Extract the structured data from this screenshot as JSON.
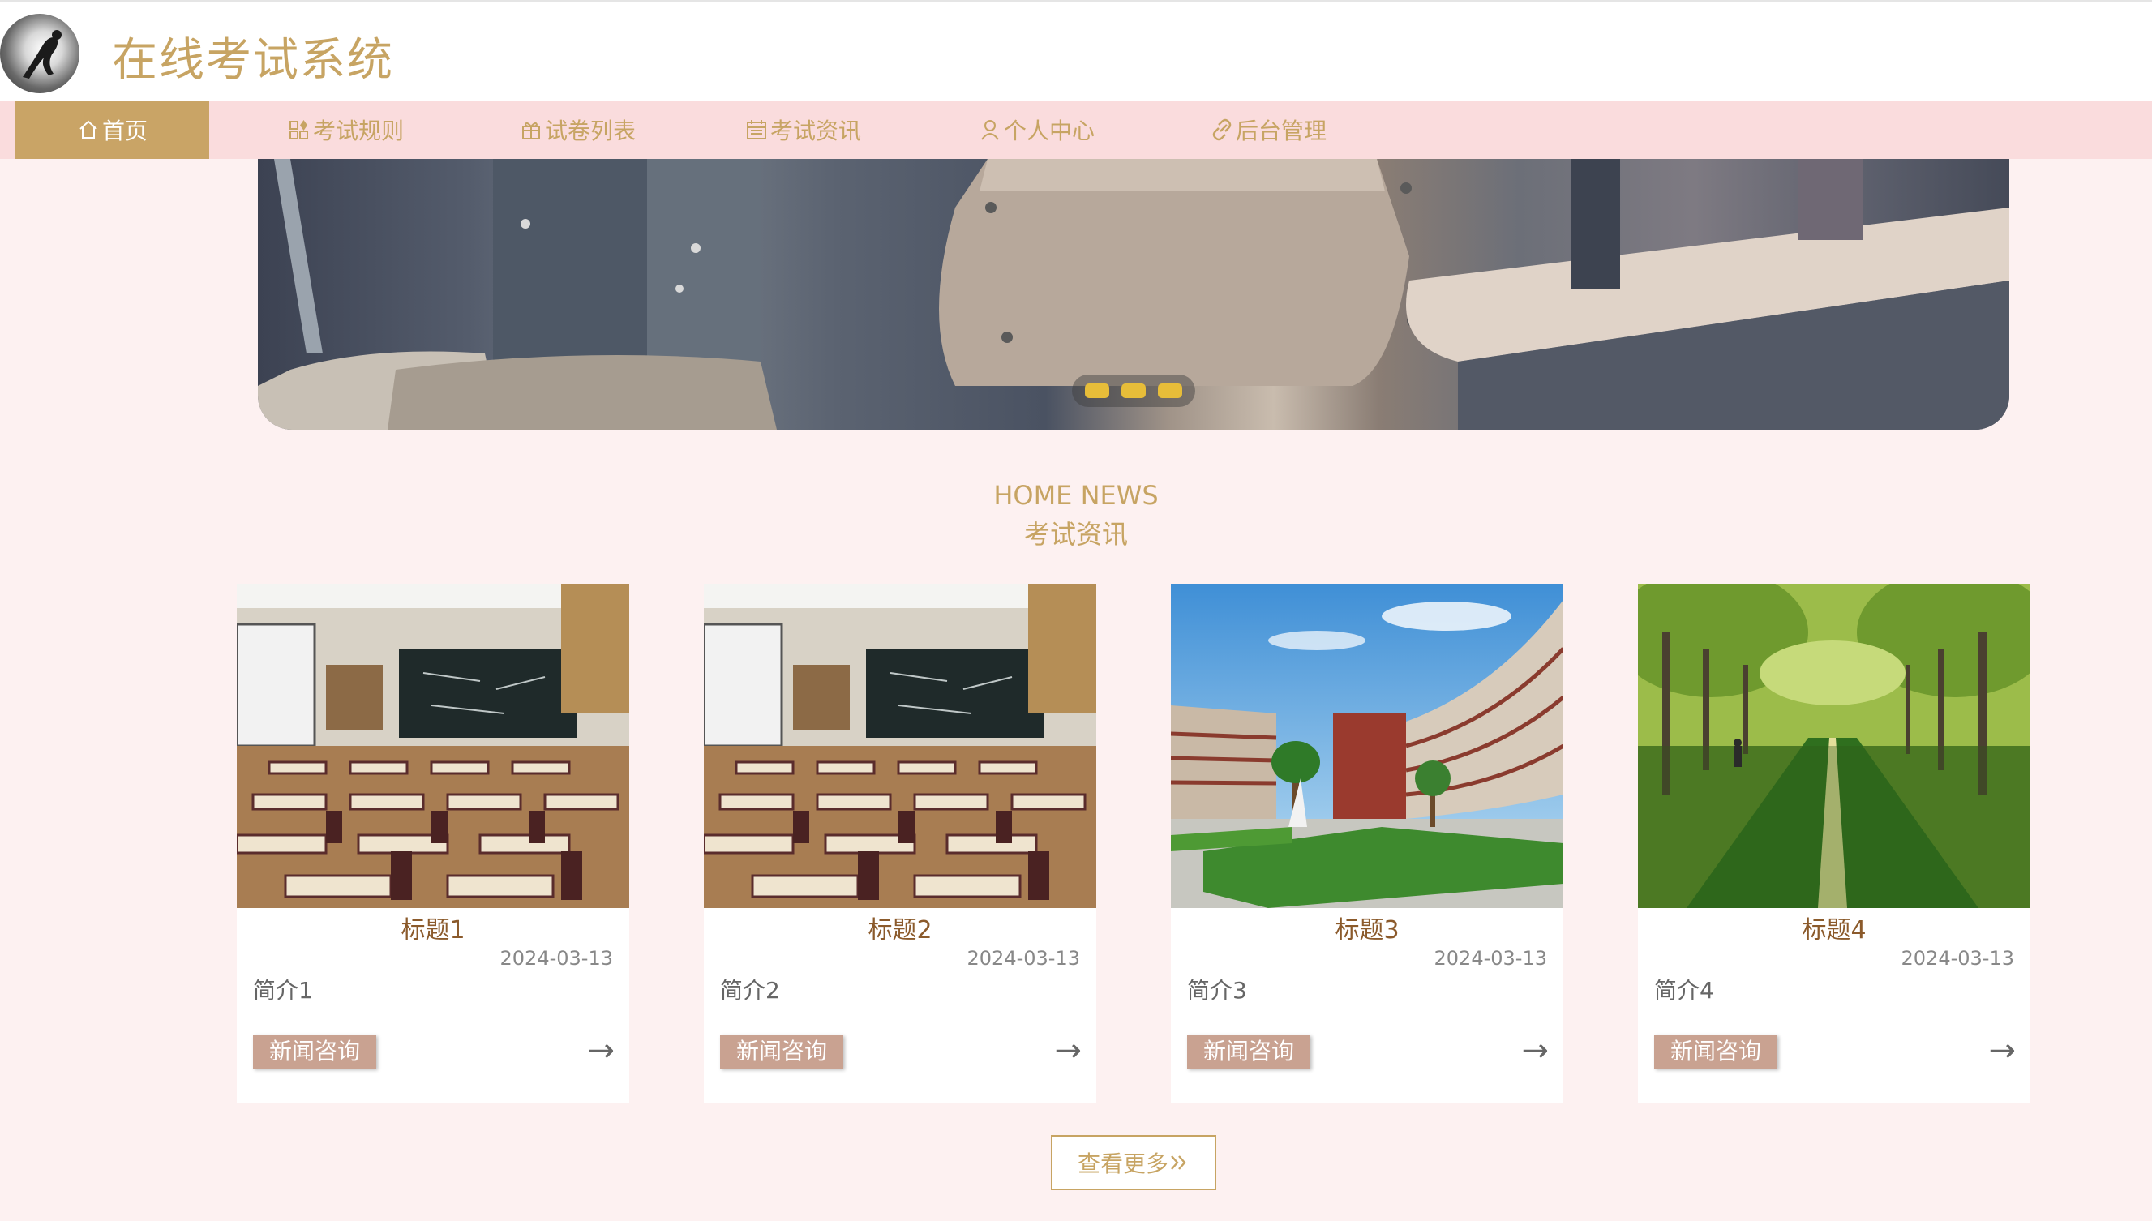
{
  "header": {
    "site_title": "在线考试系统"
  },
  "nav": {
    "items": [
      {
        "label": "首页",
        "icon": "home-icon",
        "active": true
      },
      {
        "label": "考试规则",
        "icon": "grid-icon",
        "active": false
      },
      {
        "label": "试卷列表",
        "icon": "gift-icon",
        "active": false
      },
      {
        "label": "考试资讯",
        "icon": "calendar-icon",
        "active": false
      },
      {
        "label": "个人中心",
        "icon": "user-icon",
        "active": false
      },
      {
        "label": "后台管理",
        "icon": "link-icon",
        "active": false
      }
    ]
  },
  "banner": {
    "slide_count": 3
  },
  "section": {
    "title_en": "HOME NEWS",
    "title_cn": "考试资讯"
  },
  "news": [
    {
      "title": "标题1",
      "date": "2024-03-13",
      "desc": "简介1",
      "button": "新闻咨询",
      "arrow": "→",
      "image": "classroom"
    },
    {
      "title": "标题2",
      "date": "2024-03-13",
      "desc": "简介2",
      "button": "新闻咨询",
      "arrow": "→",
      "image": "classroom"
    },
    {
      "title": "标题3",
      "date": "2024-03-13",
      "desc": "简介3",
      "button": "新闻咨询",
      "arrow": "→",
      "image": "campus-building"
    },
    {
      "title": "标题4",
      "date": "2024-03-13",
      "desc": "简介4",
      "button": "新闻咨询",
      "arrow": "→",
      "image": "tree-lined-road"
    }
  ],
  "more": {
    "label": "查看更多"
  },
  "colors": {
    "accent": "#c7a463",
    "nav_bg": "#fadcdd",
    "page_bg": "#fdf1f1",
    "button": "#c9a291",
    "dot": "#e7bd39"
  }
}
